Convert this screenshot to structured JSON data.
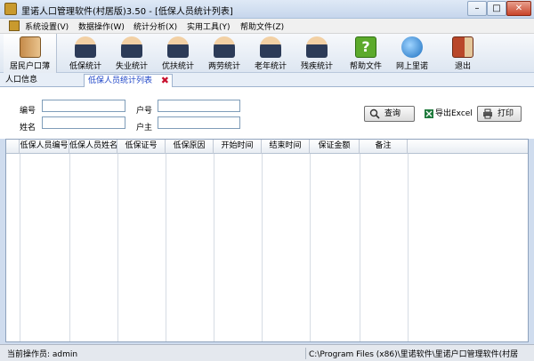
{
  "window": {
    "title": "里诺人口管理软件(村居版)3.50 - [低保人员统计列表]",
    "min": "–",
    "max": "□",
    "close": "✕"
  },
  "menu": [
    "系统设置(V)",
    "数据操作(W)",
    "统计分析(X)",
    "实用工具(Y)",
    "帮助文件(Z)"
  ],
  "toolbar": {
    "household": "居民户口薄",
    "low_income": "低保统计",
    "unemployed": "失业统计",
    "preferential": "优扶统计",
    "two_labor": "两劳统计",
    "elderly": "老年统计",
    "disabled": "残疾统计",
    "help": "帮助文件",
    "online": "网上里诺",
    "exit": "退出",
    "help_glyph": "?"
  },
  "tabs": {
    "population": "人口信息",
    "low_income_list": "低保人员统计列表",
    "close_glyph": "✖"
  },
  "form": {
    "id_label": "编号",
    "household_no_label": "户号",
    "name_label": "姓名",
    "head_label": "户主",
    "query_button": "查询",
    "export_button": "导出Excel",
    "print_button": "打印"
  },
  "grid": {
    "columns": [
      "低保人员编号",
      "低保人员姓名",
      "低保证号",
      "低保原因",
      "开始时间",
      "结束时间",
      "保证金额",
      "备注"
    ]
  },
  "status": {
    "operator": "当前操作员: admin",
    "path": "C:\\Program Files (x86)\\里诺软件\\里诺户口管理软件(村居"
  }
}
